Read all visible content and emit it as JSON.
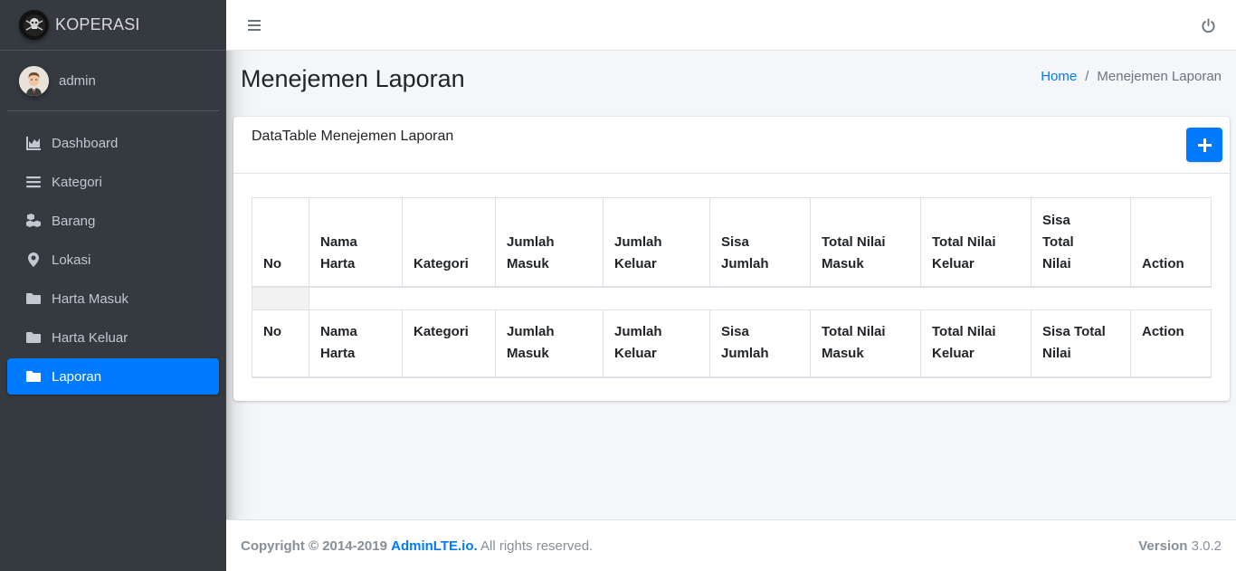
{
  "brand": {
    "name": "KOPERASI"
  },
  "user": {
    "name": "admin"
  },
  "sidebar": {
    "items": [
      {
        "label": "Dashboard",
        "icon": "area-chart-icon"
      },
      {
        "label": "Kategori",
        "icon": "list-icon"
      },
      {
        "label": "Barang",
        "icon": "cubes-icon"
      },
      {
        "label": "Lokasi",
        "icon": "map-marker-icon"
      },
      {
        "label": "Harta Masuk",
        "icon": "folder-icon"
      },
      {
        "label": "Harta Keluar",
        "icon": "folder-icon"
      },
      {
        "label": "Laporan",
        "icon": "folder-icon",
        "active": true
      }
    ]
  },
  "page": {
    "title": "Menejemen Laporan",
    "breadcrumb": {
      "home": "Home",
      "sep": "/",
      "current": "Menejemen Laporan"
    }
  },
  "card": {
    "title": "DataTable Menejemen Laporan"
  },
  "table": {
    "header": [
      [
        "No"
      ],
      [
        "Nama",
        "Harta"
      ],
      [
        "Kategori"
      ],
      [
        "Jumlah",
        "Masuk"
      ],
      [
        "Jumlah",
        "Keluar"
      ],
      [
        "Sisa",
        "Jumlah"
      ],
      [
        "Total Nilai",
        "Masuk"
      ],
      [
        "Total Nilai",
        "Keluar"
      ],
      [
        "Sisa",
        "Total",
        "Nilai"
      ],
      [
        "Action"
      ]
    ],
    "footer": [
      [
        "No"
      ],
      [
        "Nama",
        "Harta"
      ],
      [
        "Kategori"
      ],
      [
        "Jumlah",
        "Masuk"
      ],
      [
        "Jumlah",
        "Keluar"
      ],
      [
        "Sisa Jumlah"
      ],
      [
        "Total Nilai",
        "Masuk"
      ],
      [
        "Total Nilai",
        "Keluar"
      ],
      [
        "Sisa Total",
        "Nilai"
      ],
      [
        "Action"
      ]
    ]
  },
  "footer": {
    "copyright": "Copyright © 2014-2019",
    "link": "AdminLTE.io.",
    "rights": "All rights reserved.",
    "version_label": "Version",
    "version": "3.0.2"
  },
  "colors": {
    "primary": "#007bff",
    "sidebar_bg": "#343a40",
    "content_bg": "#f4f6f9"
  }
}
